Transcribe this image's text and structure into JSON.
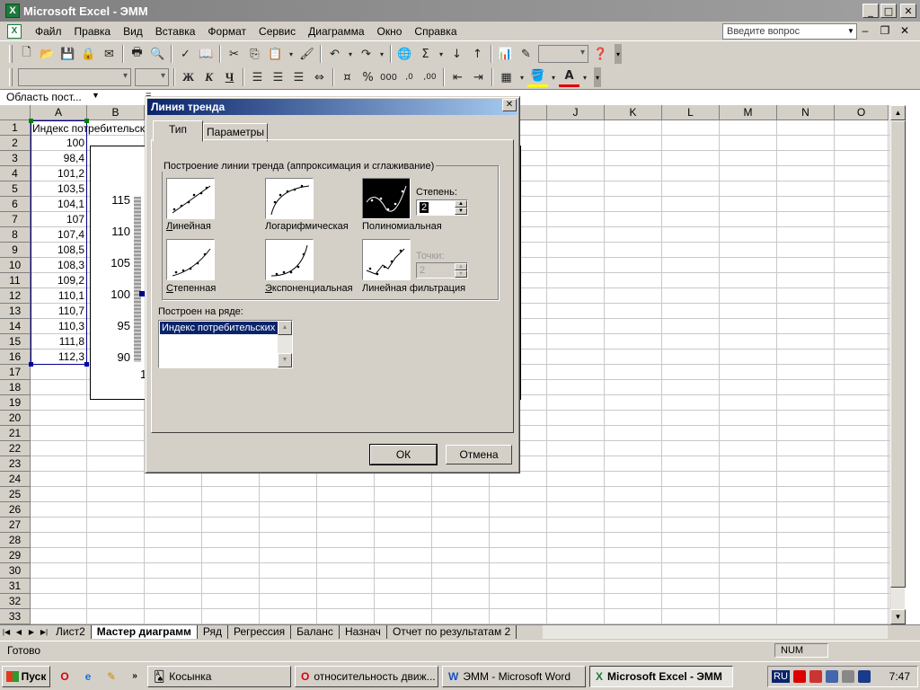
{
  "window": {
    "title": "Microsoft Excel - ЭММ",
    "app_icon": "X"
  },
  "menu": {
    "items": [
      "Файл",
      "Правка",
      "Вид",
      "Вставка",
      "Формат",
      "Сервис",
      "Диаграмма",
      "Окно",
      "Справка"
    ],
    "ask_placeholder": "Введите вопрос"
  },
  "formula_bar": {
    "name_box": "Область пост...",
    "fx_glyph": "="
  },
  "grid": {
    "columns": [
      "A",
      "B",
      "C",
      "D",
      "E",
      "F",
      "G",
      "H",
      "I",
      "J",
      "K",
      "L",
      "M",
      "N",
      "O"
    ],
    "rows": [
      "1",
      "2",
      "3",
      "4",
      "5",
      "6",
      "7",
      "8",
      "9",
      "10",
      "11",
      "12",
      "13",
      "14",
      "15",
      "16",
      "17",
      "18",
      "19",
      "20",
      "21",
      "22",
      "23",
      "24",
      "25",
      "26",
      "27",
      "28",
      "29",
      "30",
      "31",
      "32",
      "33"
    ],
    "a1": "Индекс потребительских цен",
    "values": [
      "100",
      "98,4",
      "101,2",
      "103,5",
      "104,1",
      "107",
      "107,4",
      "108,5",
      "108,3",
      "109,2",
      "110,1",
      "110,7",
      "110,3",
      "111,8",
      "112,3"
    ]
  },
  "chart": {
    "y_ticks": [
      "115",
      "110",
      "105",
      "100",
      "95",
      "90"
    ],
    "x_first_label": "1"
  },
  "dialog": {
    "title": "Линия тренда",
    "close_glyph": "✕",
    "tabs": [
      "Тип",
      "Параметры"
    ],
    "group_title": "Построение линии тренда (аппроксимация и сглаживание)",
    "trend_types": {
      "linear": "Линейная",
      "log": "Логарифмическая",
      "poly": "Полиномиальная",
      "power": "Степенная",
      "exp": "Экспоненциальная",
      "ma": "Линейная фильтрация"
    },
    "degree_label": "Степень:",
    "degree_value": "2",
    "points_label": "Точки:",
    "points_value": "2",
    "series_label": "Построен на ряде:",
    "series_item": "Индекс потребительских цен",
    "ok_label": "ОК",
    "cancel_label": "Отмена"
  },
  "sheet_tabs": [
    "Лист2",
    "Мастер диаграмм",
    "Ряд",
    "Регрессия",
    "Баланс",
    "Назнач",
    "Отчет по результатам 2"
  ],
  "status": {
    "ready": "Готово",
    "num": "NUM"
  },
  "taskbar": {
    "start_label": "Пуск",
    "buttons": [
      "Косынка",
      "относительность движ...",
      "ЭММ - Microsoft Word",
      "Microsoft Excel - ЭММ"
    ],
    "lang": "RU",
    "clock": "7:47"
  },
  "colors": {
    "selection": "#0a246a",
    "face": "#d4d0c8"
  }
}
